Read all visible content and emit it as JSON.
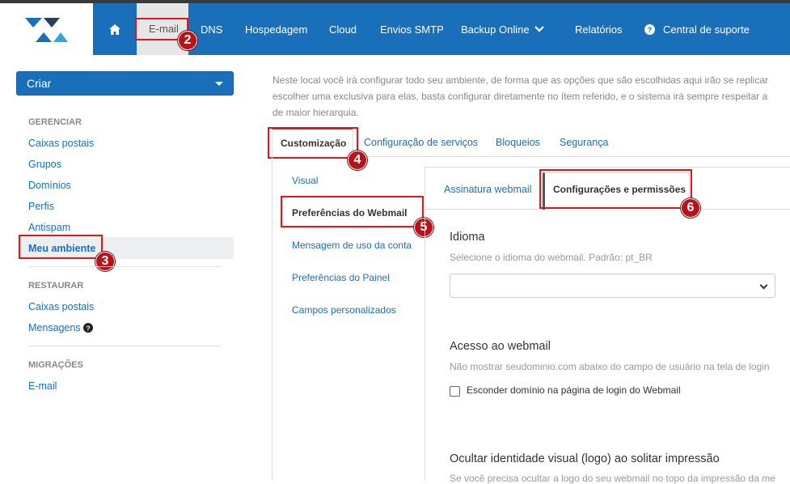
{
  "nav": {
    "items": [
      {
        "label": "E-mail"
      },
      {
        "label": "DNS"
      },
      {
        "label": "Hospedagem"
      },
      {
        "label": "Cloud"
      },
      {
        "label": "Envios SMTP"
      },
      {
        "label": "Backup Online"
      },
      {
        "label": "Relatórios"
      },
      {
        "label": "Central de suporte"
      }
    ]
  },
  "sidebar": {
    "create_label": "Criar",
    "manage_heading": "GERENCIAR",
    "manage_items": [
      "Caixas postais",
      "Grupos",
      "Domínios",
      "Perfis",
      "Antispam",
      "Meu ambiente"
    ],
    "restore_heading": "RESTAURAR",
    "restore_items": [
      "Caixas postais",
      "Mensagens"
    ],
    "migrations_heading": "MIGRAÇÕES",
    "migration_items": [
      "E-mail"
    ]
  },
  "main": {
    "intro_lines": [
      "Neste local você irá configurar todo seu ambiente, de forma que as opções que são escolhidas aqui irão se replicar",
      "escolher uma exclusiva para elas, basta configurar diretamente no ítem referido, e o sistema irá sempre respeitar a",
      "de maior hierarquia."
    ],
    "tabs": [
      "Customização",
      "Configuração de serviços",
      "Bloqueios",
      "Segurança"
    ],
    "subnav": [
      "Visual",
      "Preferências do Webmail",
      "Mensagem de uso da conta",
      "Preferências do Painel",
      "Campos personalizados"
    ],
    "inner_tabs": [
      "Assinatura webmail",
      "Configurações e permissões"
    ],
    "language": {
      "title": "Idioma",
      "help": "Selecione o idioma do webmail. Padrão: pt_BR",
      "value": ""
    },
    "webmail_access": {
      "title": "Acesso ao webmail",
      "help": "Não mostrar seudominio.com abaixo do campo de usuário na tela de login",
      "checkbox_label": "Esconder domínio na página de login do Webmail"
    },
    "hide_logo": {
      "title": "Ocultar identidade visual (logo) ao solitar impressão",
      "help": "Se você precisa ocultar a logo do seu webmail no topo da impressão da me"
    }
  },
  "annotations": [
    "2",
    "3",
    "4",
    "5",
    "6"
  ],
  "colors": {
    "brand": "#1a6fba",
    "highlight": "#e0161d",
    "badge": "#b5141a"
  }
}
